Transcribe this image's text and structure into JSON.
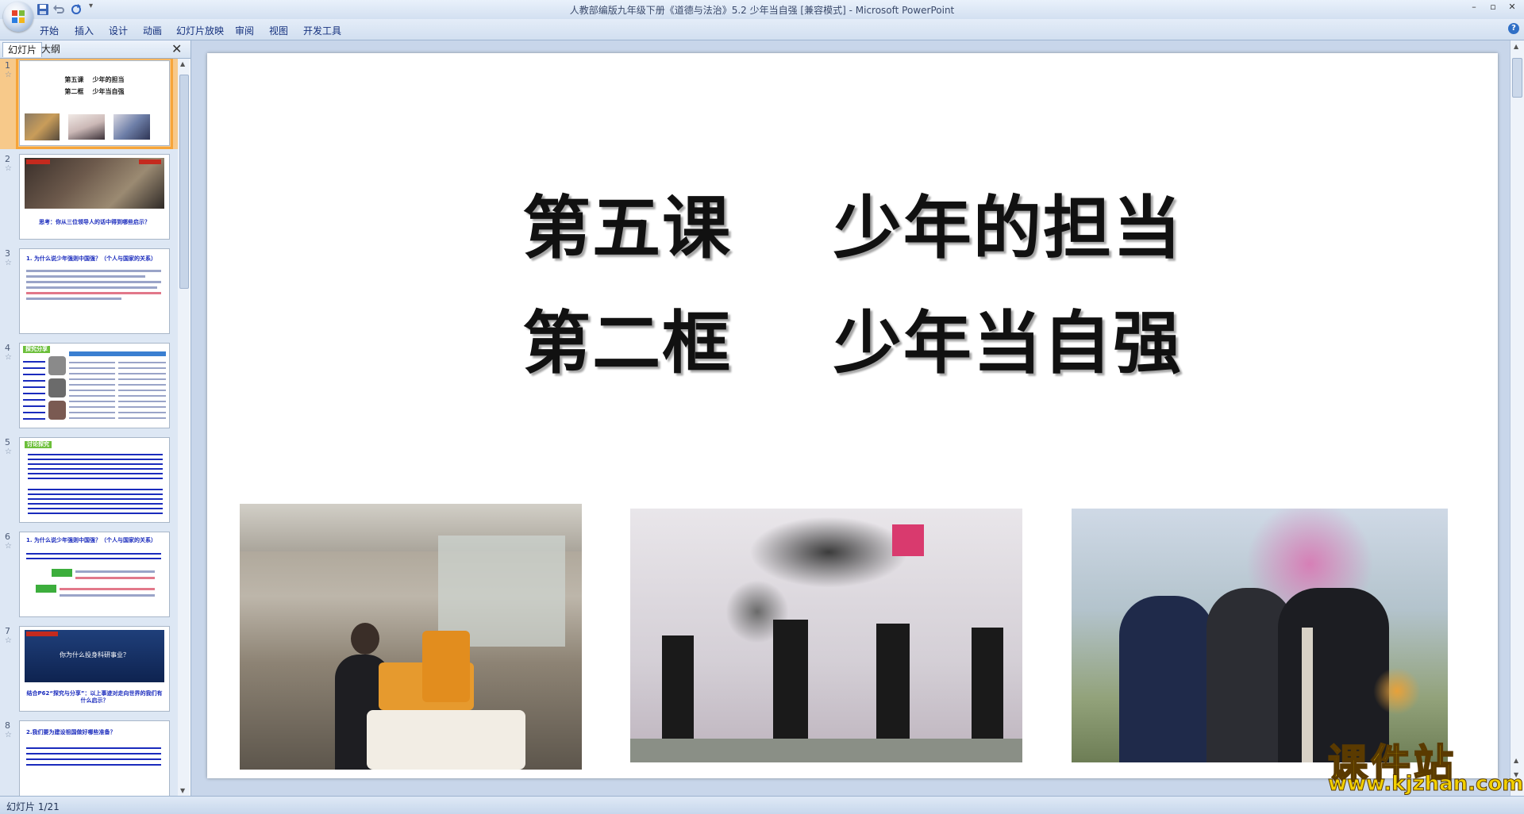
{
  "window": {
    "title": "人教部编版九年级下册《道德与法治》5.2 少年当自强 [兼容模式] - Microsoft PowerPoint"
  },
  "ribbon": {
    "tabs": [
      "开始",
      "插入",
      "设计",
      "动画",
      "幻灯片放映",
      "审阅",
      "视图",
      "开发工具"
    ]
  },
  "panel": {
    "tabs": [
      "幻灯片",
      "大纲"
    ]
  },
  "thumbnails": [
    {
      "num": "1",
      "line1": "第五课    少年的担当",
      "line2": "第二框    少年当自强"
    },
    {
      "num": "2",
      "caption": "思考：你从三位领导人的话中得到哪些启示？"
    },
    {
      "num": "3",
      "heading": "1. 为什么说少年强则中国强？（个人与国家的关系）"
    },
    {
      "num": "4",
      "heading": "探究分享"
    },
    {
      "num": "5",
      "heading": "讨论探究"
    },
    {
      "num": "6",
      "heading": "1. 为什么说少年强则中国强？（个人与国家的关系）"
    },
    {
      "num": "7",
      "heading": "你为什么投身科研事业？",
      "caption": "结合P62“探究与分享”：以上事迹对走向世界的我们有什么启示？"
    },
    {
      "num": "8",
      "heading": "2.我们要为建设祖国做好哪些准备？"
    }
  ],
  "slide": {
    "title_line1": "第五课    少年的担当",
    "title_line2": "第二框    少年当自强"
  },
  "status": {
    "slide_counter": "幻灯片 1/21"
  },
  "watermark": {
    "brand": "课件站",
    "url": "www.kjzhan.com"
  }
}
